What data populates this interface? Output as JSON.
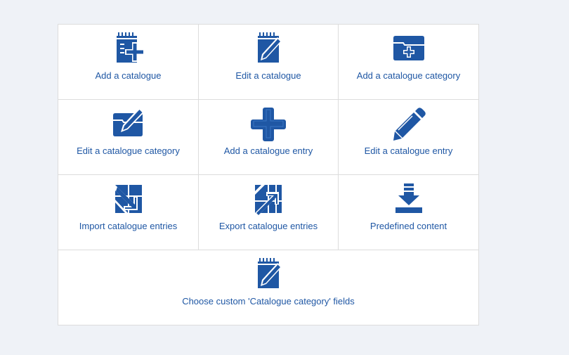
{
  "accent_color": "#1f57a4",
  "tiles": [
    {
      "label": "Add a catalogue",
      "icon": "notepad-add-icon"
    },
    {
      "label": "Edit a catalogue",
      "icon": "notepad-edit-icon"
    },
    {
      "label": "Add a catalogue category",
      "icon": "folder-add-icon"
    },
    {
      "label": "Edit a catalogue category",
      "icon": "folder-edit-icon"
    },
    {
      "label": "Add a catalogue entry",
      "icon": "plus-icon"
    },
    {
      "label": "Edit a catalogue entry",
      "icon": "pencil-icon"
    },
    {
      "label": "Import catalogue entries",
      "icon": "import-icon"
    },
    {
      "label": "Export catalogue entries",
      "icon": "export-icon"
    },
    {
      "label": "Predefined content",
      "icon": "download-icon"
    },
    {
      "label": "Choose custom 'Catalogue category' fields",
      "icon": "notepad-edit-icon"
    }
  ]
}
